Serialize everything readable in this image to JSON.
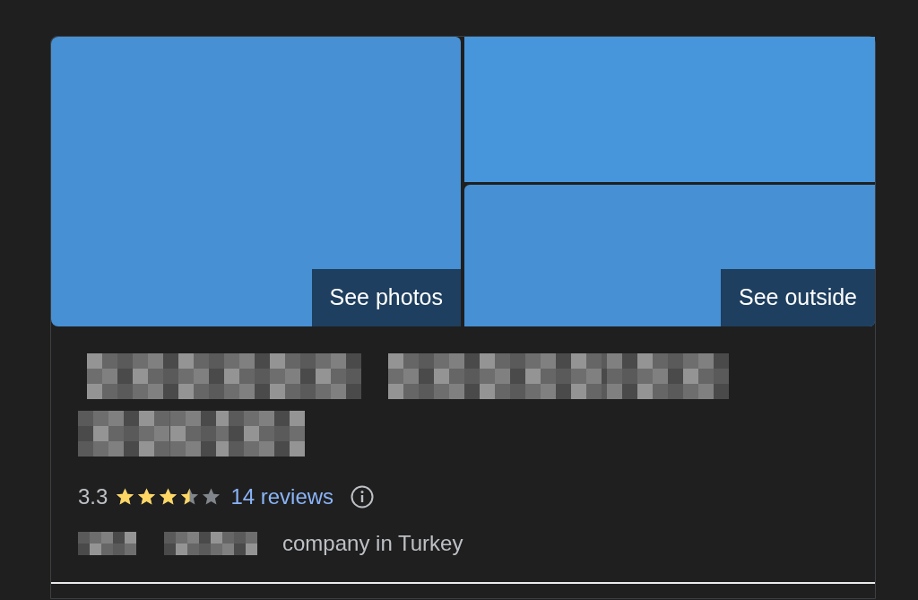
{
  "photos": [
    {
      "kind": "photo",
      "button": "See photos"
    },
    {
      "kind": "photo"
    },
    {
      "kind": "photo",
      "button": "See outside"
    }
  ],
  "rating": {
    "score": "3.3",
    "stars": 3.5,
    "reviews": "14 reviews"
  },
  "category": "company in Turkey"
}
